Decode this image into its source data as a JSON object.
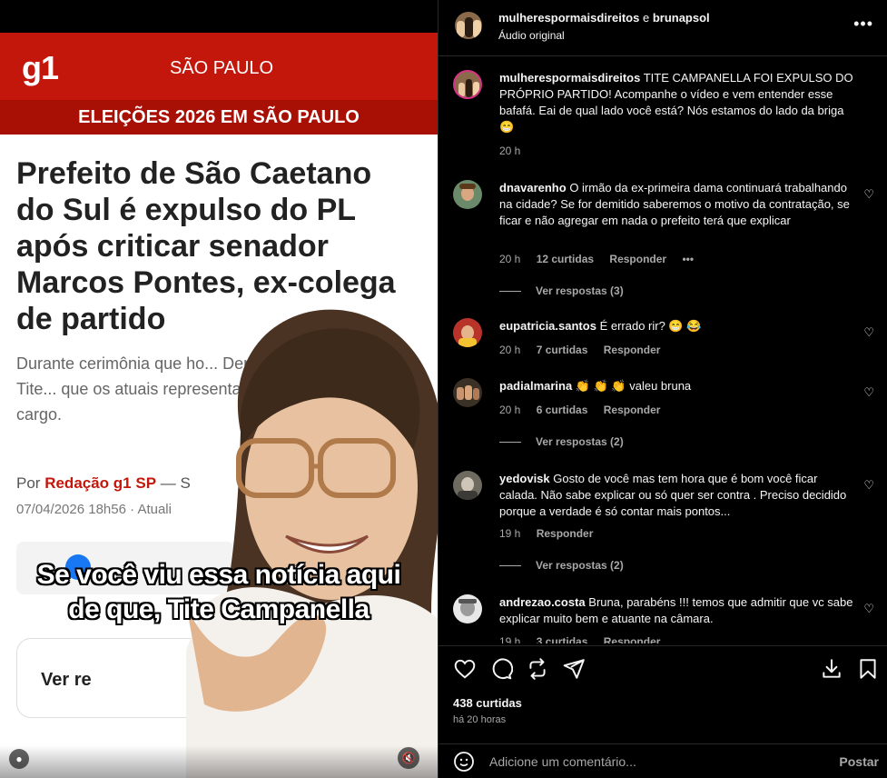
{
  "video": {
    "article": {
      "brand": "g1",
      "region": "SÃO PAULO",
      "section": "ELEIÇÕES 2026 EM SÃO PAULO",
      "headline": "Prefeito de São Caetano do Sul é expulso do PL após criticar senador Marcos Pontes, ex-colega de partido",
      "summary": "Durante cerimônia que ho... Derrite (PP), o prefeito Tite... que os atuais representa... estão à altura do cargo.",
      "byline_prefix": "Por",
      "byline_author": "Redação g1 SP",
      "byline_suffix": "— S",
      "date": "07/04/2026 18h56 · Atuali",
      "read_more": "Ver re"
    },
    "caption_line1": "Se você viu essa notícia aqui",
    "caption_line2": "de que, Tite Campanella"
  },
  "header": {
    "user1": "mulherespormaisdireitos",
    "and": "e",
    "user2": "brunapsol",
    "audio": "Áudio original"
  },
  "caption_comment": {
    "user": "mulherespormaisdireitos",
    "text": "TITE CAMPANELLA FOI EXPULSO DO PRÓPRIO PARTIDO! Acompanhe o vídeo e vem entender esse bafafá. Eai de qual lado você está? Nós estamos do lado da briga 😁",
    "time": "20 h"
  },
  "comments": [
    {
      "user": "dnavarenho",
      "text": "O irmão da ex-primeira dama continuará trabalhando na cidade? Se for demitido saberemos o motivo da contratação, se ficar e não agregar em nada o prefeito terá que explicar",
      "time": "20 h",
      "likes": "12 curtidas",
      "reply": "Responder",
      "more": "•••",
      "replies": "Ver respostas (3)"
    },
    {
      "user": "eupatricia.santos",
      "text": "É errado rir? 😁 😂",
      "time": "20 h",
      "likes": "7 curtidas",
      "reply": "Responder"
    },
    {
      "user": "padialmarina",
      "text": "👏 👏 👏 valeu bruna",
      "time": "20 h",
      "likes": "6 curtidas",
      "reply": "Responder",
      "replies": "Ver respostas (2)"
    },
    {
      "user": "yedovisk",
      "text": "Gosto de você mas tem hora que é bom você ficar calada. Não sabe explicar ou só quer ser contra . Preciso decidido porque a verdade é só contar mais pontos...",
      "time": "19 h",
      "reply": "Responder",
      "replies": "Ver respostas (2)"
    },
    {
      "user": "andrezao.costa",
      "text": "Bruna, parabéns !!! temos que admitir que vc sabe explicar muito bem e atuante na câmara.",
      "time": "19 h",
      "likes": "3 curtidas",
      "reply": "Responder"
    }
  ],
  "footer": {
    "likes": "438 curtidas",
    "ago": "há 20 horas",
    "placeholder": "Adicione um comentário...",
    "post": "Postar"
  },
  "icons": [
    "heart-icon",
    "comment-icon",
    "repost-icon",
    "share-icon",
    "save-icon",
    "bookmark-icon",
    "emoji-icon",
    "more-icon",
    "mute-icon",
    "user-tag-icon"
  ],
  "colors": {
    "g1_red": "#c4170c",
    "panel_bg": "#000000",
    "secondary_text": "#a8a8a8"
  }
}
